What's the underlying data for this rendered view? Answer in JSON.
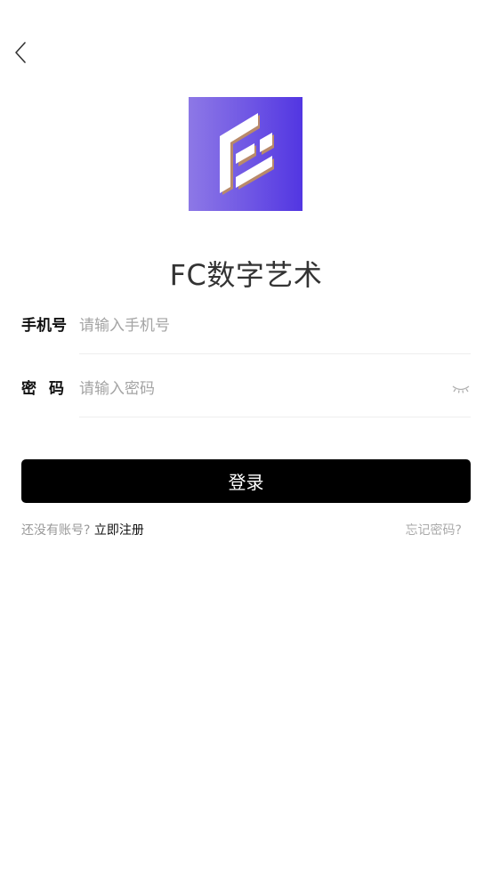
{
  "header": {
    "back_icon": "chevron-left-icon"
  },
  "logo": {
    "icon": "fc-logo-icon",
    "gradient": [
      "#8d78e6",
      "#5236e2"
    ]
  },
  "app": {
    "title": "FC数字艺术"
  },
  "form": {
    "phone": {
      "label": "手机号",
      "placeholder": "请输入手机号",
      "value": ""
    },
    "password": {
      "label": "密码",
      "placeholder": "请输入密码",
      "value": "",
      "toggle_icon": "eye-closed-icon"
    }
  },
  "login_button": {
    "label": "登录",
    "color": "#000000"
  },
  "links": {
    "no_account": "还没有账号?",
    "register": "立即注册",
    "forgot": "忘记密码?"
  }
}
